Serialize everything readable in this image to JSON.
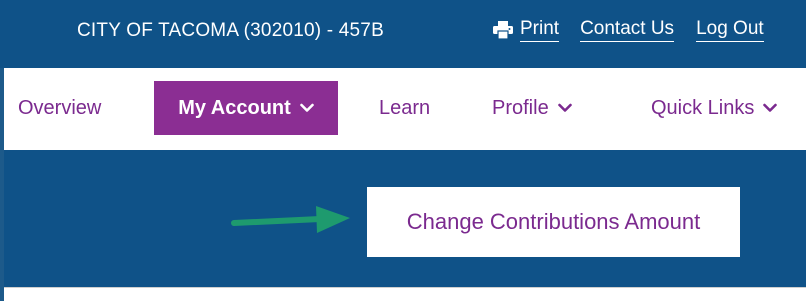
{
  "header": {
    "account_title": "CITY OF TACOMA (302010) - 457B",
    "links": {
      "print": "Print",
      "contact": "Contact Us",
      "logout": "Log Out"
    }
  },
  "nav": {
    "items": [
      {
        "label": "Overview"
      },
      {
        "label": "My Account",
        "active": true
      },
      {
        "label": "Learn"
      },
      {
        "label": "Profile"
      },
      {
        "label": "Quick Links"
      }
    ]
  },
  "main": {
    "action_label": "Change Contributions Amount"
  },
  "colors": {
    "brand_blue": "#0f5288",
    "brand_purple": "#8b2e93",
    "arrow_green": "#1e9a6e"
  },
  "icons": [
    "printer-icon",
    "chevron-down-icon",
    "annotation-arrow"
  ]
}
